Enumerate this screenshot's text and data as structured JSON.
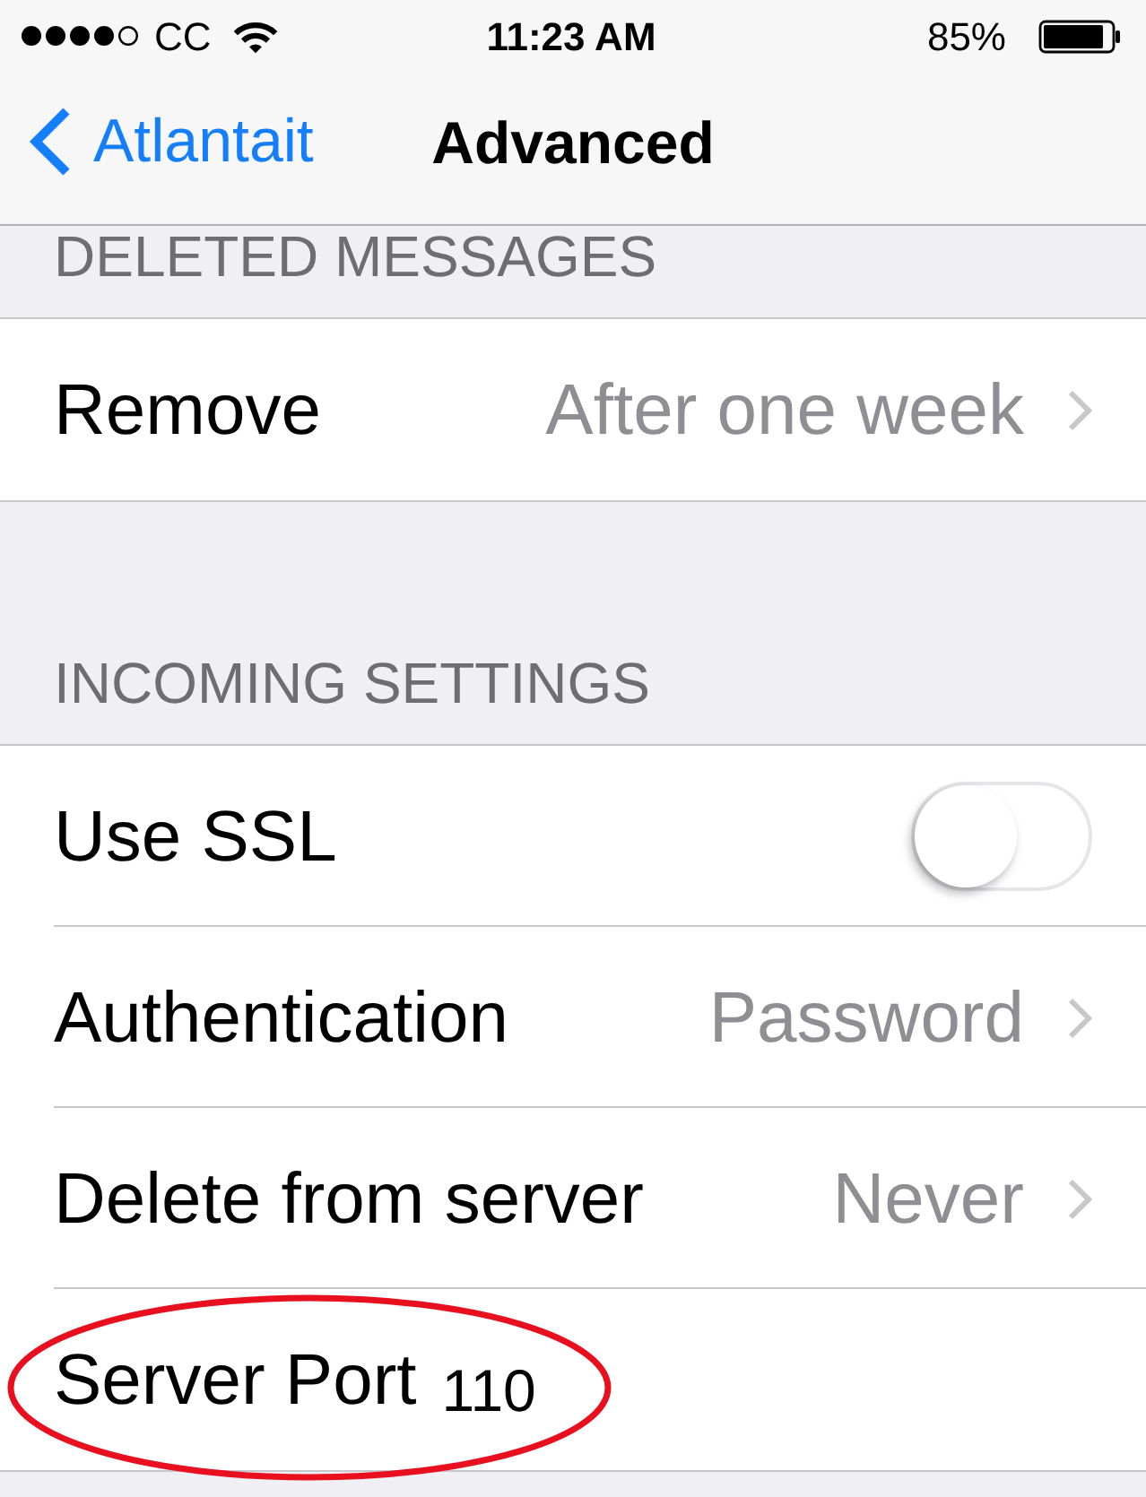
{
  "status_bar": {
    "carrier": "CC",
    "time": "11:23 AM",
    "battery": "85%"
  },
  "nav_bar": {
    "back": "Atlantait",
    "title": "Advanced"
  },
  "sections": [
    {
      "header": "DELETED MESSAGES",
      "rows": [
        {
          "kind": "disclosure",
          "label": "Remove",
          "value": "After one week",
          "circled": false
        }
      ]
    },
    {
      "header": "INCOMING SETTINGS",
      "rows": [
        {
          "kind": "switch",
          "label": "Use SSL",
          "on": false,
          "circled": false
        },
        {
          "kind": "disclosure",
          "label": "Authentication",
          "value": "Password",
          "circled": false
        },
        {
          "kind": "disclosure",
          "label": "Delete from server",
          "value": "Never",
          "circled": false
        },
        {
          "kind": "field",
          "label": "Server Port",
          "value": "110",
          "circled": true
        }
      ]
    }
  ]
}
